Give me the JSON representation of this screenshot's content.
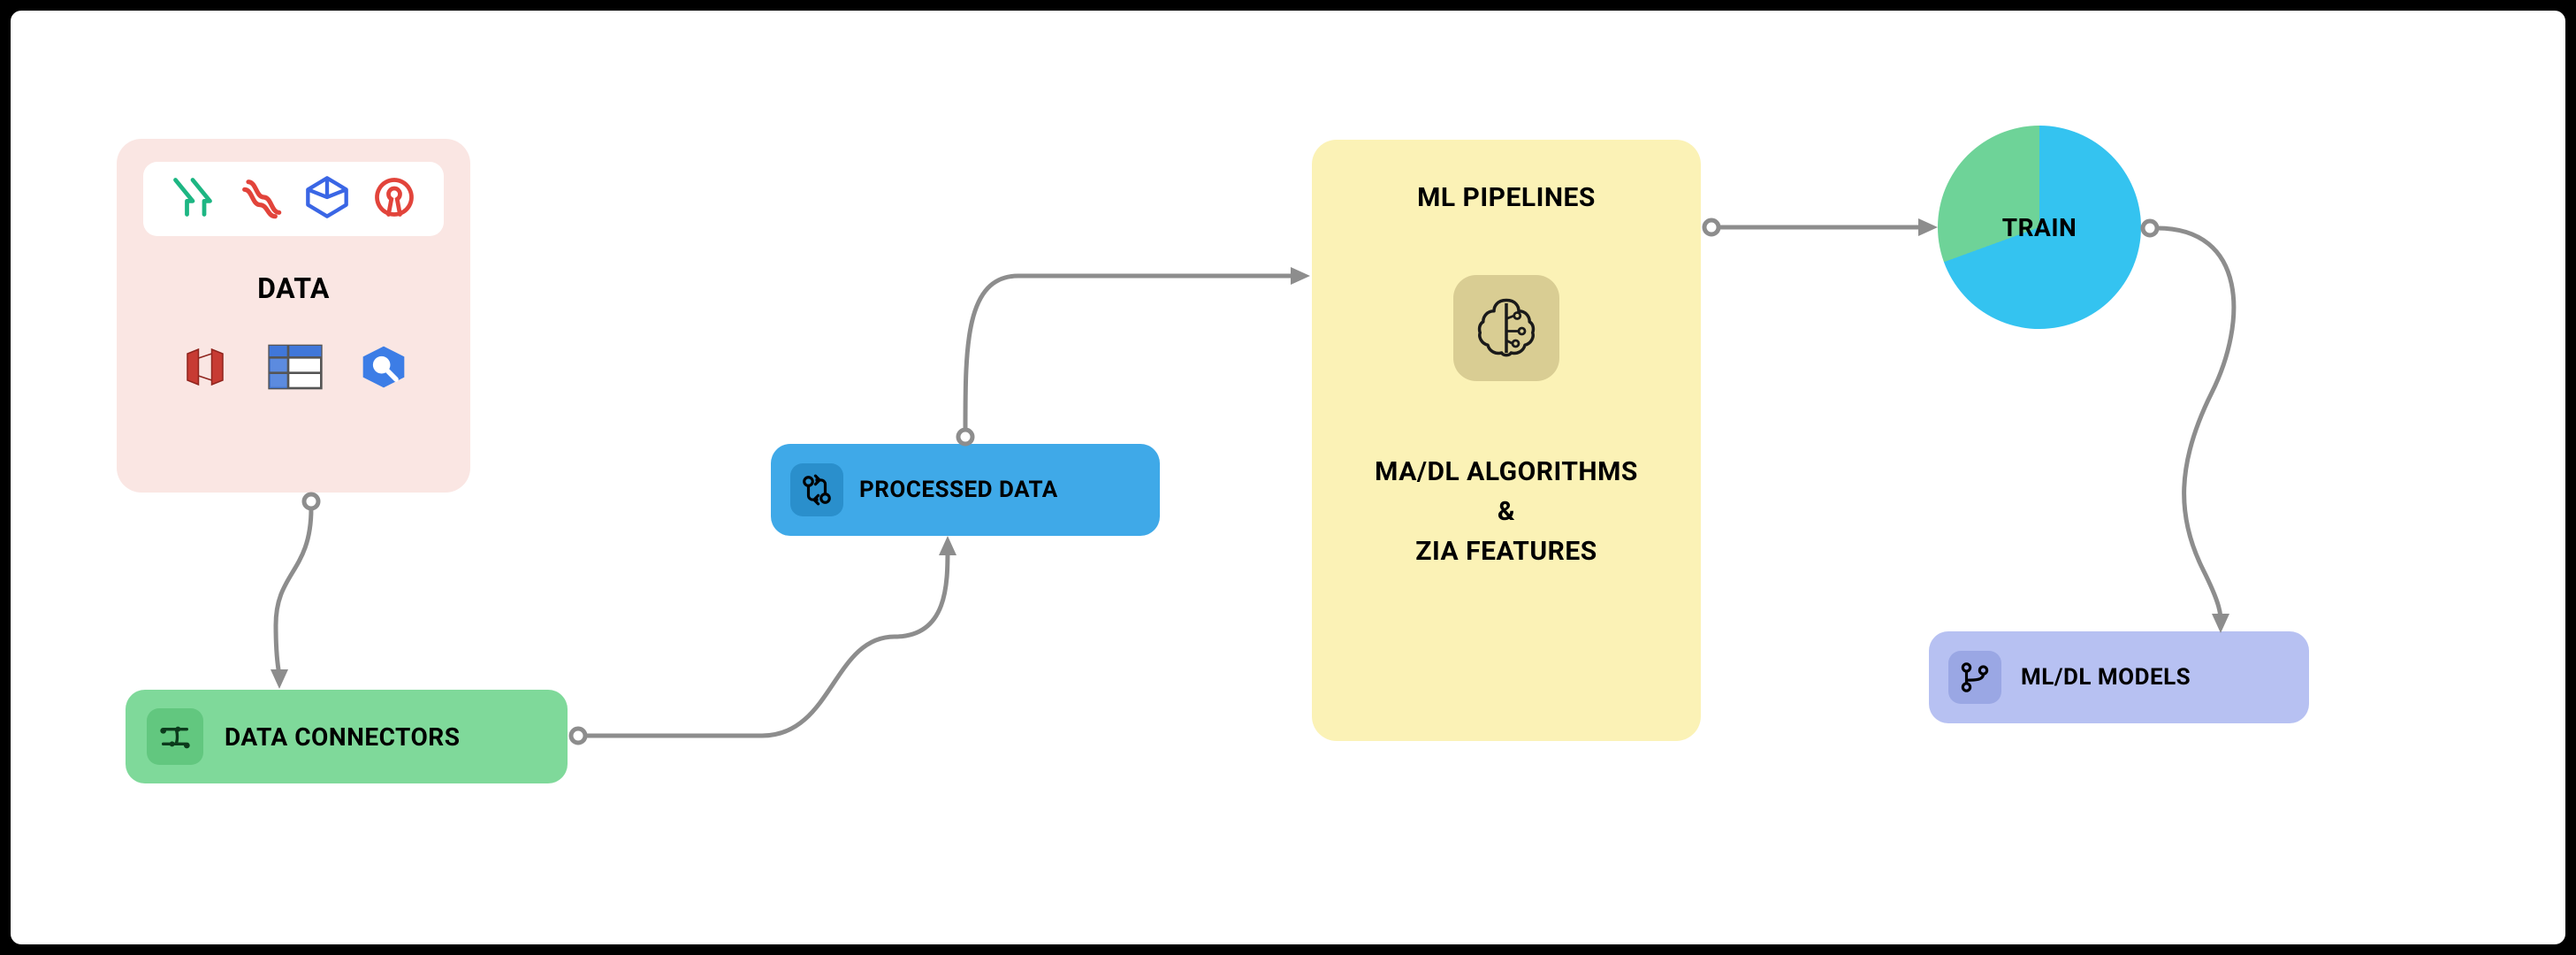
{
  "diagram": {
    "data_card": {
      "title": "DATA",
      "source_icons_row1": [
        "airbyte-icon",
        "retool-icon",
        "abstract-icon",
        "opensource-icon"
      ],
      "source_icons_row2": [
        "redshift-icon",
        "table-icon",
        "bigquery-icon"
      ]
    },
    "connectors": {
      "label": "DATA CONNECTORS",
      "icon": "connector-icon"
    },
    "processed": {
      "label": "PROCESSED DATA",
      "icon": "git-compare-icon"
    },
    "pipelines": {
      "title": "ML PIPELINES",
      "subtitle_line1": "MA/DL ALGORITHMS",
      "subtitle_amp": "&",
      "subtitle_line2": "ZIA FEATURES",
      "icon": "brain-icon"
    },
    "train": {
      "label": "TRAIN",
      "slices": [
        {
          "name": "blue",
          "color": "#34C3F0",
          "fraction": 0.69
        },
        {
          "name": "green",
          "color": "#6ED398",
          "fraction": 0.31
        }
      ]
    },
    "models": {
      "label": "ML/DL MODELS",
      "icon": "git-branch-icon"
    },
    "flow": [
      "data_card → connectors",
      "connectors → processed",
      "processed → pipelines",
      "pipelines → train",
      "train → models"
    ]
  },
  "colors": {
    "data_card_bg": "#FAE6E3",
    "connectors_bg": "#7FD99A",
    "processed_bg": "#3FA9E8",
    "pipelines_bg": "#FBF2B6",
    "models_bg": "#B7C1F2",
    "connector_line": "#8d8d8d"
  }
}
